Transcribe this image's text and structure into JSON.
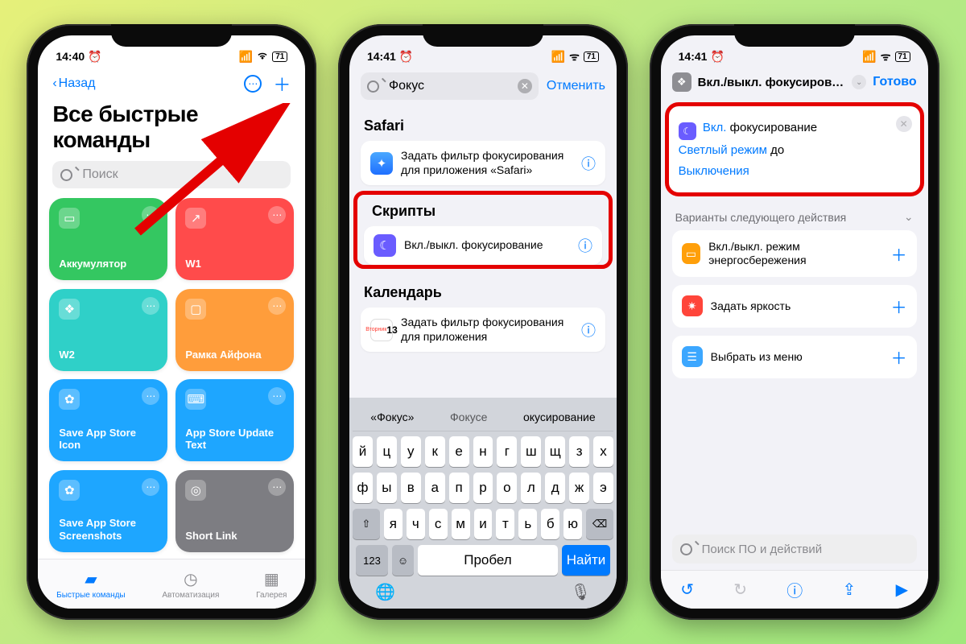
{
  "status": {
    "time1": "14:40",
    "time2": "14:41",
    "time3": "14:41",
    "battery": "71"
  },
  "p1": {
    "back": "Назад",
    "title": "Все быстрые команды",
    "search_ph": "Поиск",
    "tiles": [
      {
        "label": "Аккумулятор"
      },
      {
        "label": "W1"
      },
      {
        "label": "W2"
      },
      {
        "label": "Рамка Айфона"
      },
      {
        "label": "Save App Store Icon"
      },
      {
        "label": "App Store Update Text"
      },
      {
        "label": "Save App Store Screenshots"
      },
      {
        "label": "Short Link"
      }
    ],
    "tabs": {
      "shortcuts": "Быстрые команды",
      "automation": "Автоматизация",
      "gallery": "Галерея"
    }
  },
  "p2": {
    "query": "Фокус",
    "cancel": "Отменить",
    "sect_safari": "Safari",
    "safari_item": "Задать фильтр фокусирования для приложения «Safari»",
    "sect_scripts": "Скрипты",
    "scripts_item": "Вкл./выкл. фокусирование",
    "sect_cal": "Календарь",
    "cal_day": "13",
    "cal_item": "Задать фильтр фокусирования для приложения",
    "sugg": [
      "«Фокус»",
      "Фокусе",
      "окусирование"
    ],
    "kb": {
      "r1": [
        "й",
        "ц",
        "у",
        "к",
        "е",
        "н",
        "г",
        "ш",
        "щ",
        "з",
        "х"
      ],
      "r2": [
        "ф",
        "ы",
        "в",
        "а",
        "п",
        "р",
        "о",
        "л",
        "д",
        "ж",
        "э"
      ],
      "r3": [
        "я",
        "ч",
        "с",
        "м",
        "и",
        "т",
        "ь",
        "б",
        "ю"
      ],
      "num": "123",
      "space": "Пробел",
      "find": "Найти"
    }
  },
  "p3": {
    "title": "Вкл./выкл. фокусирован…",
    "done": "Готово",
    "action": {
      "turn": "Вкл.",
      "focus": "фокусирование",
      "mode": "Светлый режим",
      "until_word": "до",
      "until": "Выключения"
    },
    "next_header": "Варианты следующего действия",
    "sugs": [
      {
        "label": "Вкл./выкл. режим энергосбережения"
      },
      {
        "label": "Задать яркость"
      },
      {
        "label": "Выбрать из меню"
      }
    ],
    "search_ph": "Поиск ПО и действий"
  }
}
